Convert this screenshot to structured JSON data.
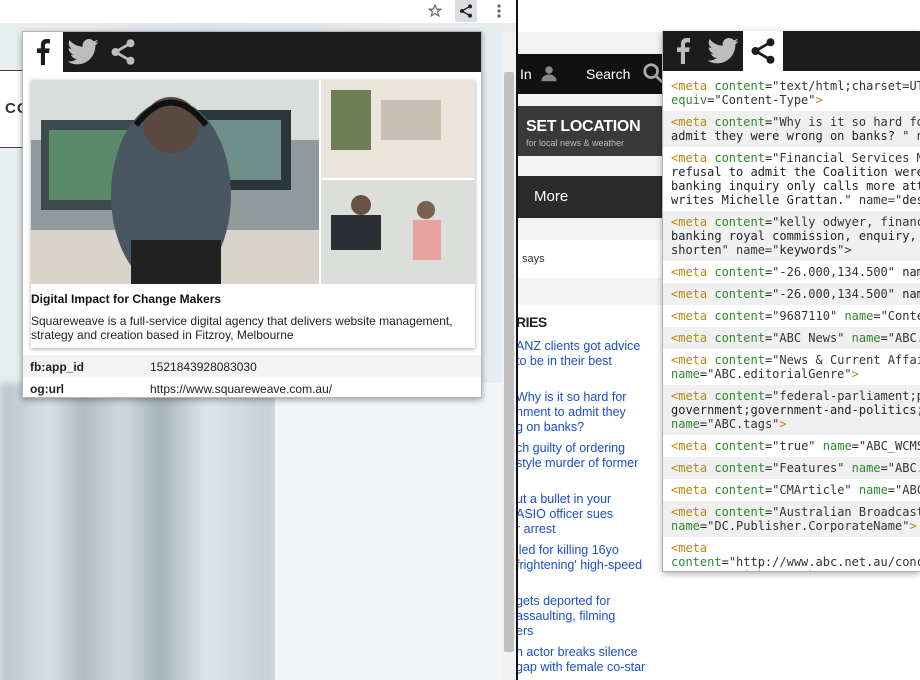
{
  "browser": {
    "star_icon": "star-icon",
    "share_icon": "share-icon",
    "menu_icon": "kebab-menu-icon"
  },
  "left_page": {
    "partial_logo_text": "CO"
  },
  "popup": {
    "tabs": [
      "facebook",
      "twitter",
      "share"
    ],
    "active_tab": "facebook",
    "preview": {
      "title": "Digital Impact for Change Makers",
      "description": "Squareweave is a full-service digital agency that delivers website management, strategy and creation based in Fitzroy, Melbourne"
    },
    "meta": [
      {
        "key": "fb:app_id",
        "value": "1521843928083030"
      },
      {
        "key": "og:url",
        "value": "https://www.squareweave.com.au/"
      }
    ]
  },
  "abc_page": {
    "sign_in_fragment": "In",
    "search_label": "Search",
    "set_location_title": "SET LOCATION",
    "set_location_sub": "for local news & weather",
    "more_label": "More",
    "says_fragment": "says",
    "list_heading_fragment": "RIES",
    "news_items": [
      "ANZ clients got advice\nto be in their best",
      "Why is it so hard for\nnment to admit they\ng on banks?",
      "ch guilty of ordering\nstyle murder of former",
      "ut a bullet in your\nASIO officer sues\nr arrest",
      "iled for killing 16yo\nfrightening' high-speed",
      "gets deported for\nassaulting, filming\ners",
      "n actor breaks silence\ngap with female co-star"
    ]
  },
  "source_popup": {
    "tabs": [
      "facebook",
      "twitter",
      "share"
    ],
    "active_tab": "share",
    "rows": [
      "<meta content=\"text/html;charset=UTF-8\"\nequiv=\"Content-Type\">",
      "<meta content=\"Why is it so hard for\nadmit they were wrong on banks? \" nam",
      "<meta content=\"Financial Services Mi\nrefusal to admit the Coalition were\nbanking inquiry only calls more atte\nwrites Michelle Grattan.\" name=\"desc",
      "<meta content=\"kelly odwyer, financ\nbanking royal commission, enquiry, b\nshorten\" name=\"keywords\">",
      "<meta content=\"-26.000,134.500\" name",
      "<meta content=\"-26.000,134.500\" name",
      "<meta content=\"9687110\" name=\"Conten",
      "<meta content=\"ABC News\" name=\"ABC.S",
      "<meta content=\"News & Current Affai\nname=\"ABC.editorialGenre\">",
      "<meta content=\"federal-parliament;pc\ngovernment;government-and-politics;p\nname=\"ABC.tags\">",
      "<meta content=\"true\" name=\"ABC_WCMS_",
      "<meta content=\"Features\" name=\"ABC.C",
      "<meta content=\"CMArticle\" name=\"ABC.",
      "<meta content=\"Australian Broadcast\nname=\"DC.Publisher.CorporateName\">",
      "<meta\ncontent=\"http://www.abc.net.au/conc\nname=\"DC.rights\" scheme=\"DCTERMS.URI"
    ]
  },
  "colors": {
    "tab_bar": "#1c1c1c",
    "link_blue": "#1a4fc9",
    "tag_gold": "#b8860b",
    "attr_green": "#2b8a2b"
  }
}
